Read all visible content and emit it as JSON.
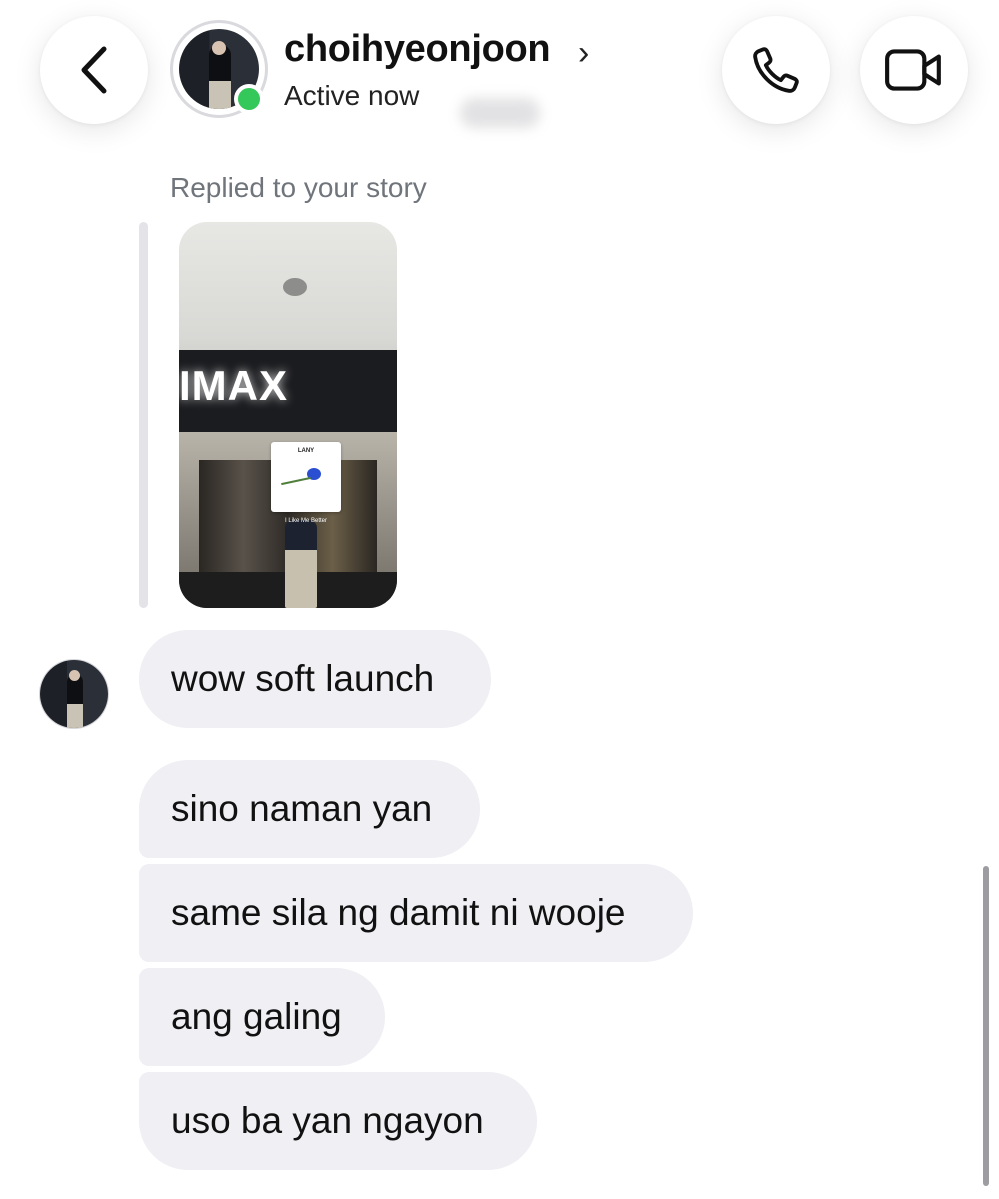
{
  "header": {
    "username": "choihyeonjoon",
    "status": "Active now",
    "chevron": "›",
    "icons": {
      "back": "chevron-left-icon",
      "call": "phone-icon",
      "video": "video-camera-icon"
    }
  },
  "story_reply": {
    "label": "Replied to your story",
    "sign_text": "IMAX",
    "sticker_title": "LANY",
    "sticker_song": "I Like Me Better"
  },
  "messages": [
    {
      "text": "wow soft launch"
    },
    {
      "text": "sino naman yan"
    },
    {
      "text": "same sila ng damit ni wooje"
    },
    {
      "text": "ang galing"
    },
    {
      "text": "uso ba yan ngayon"
    }
  ],
  "colors": {
    "online": "#34c759",
    "bubble": "#efeff4",
    "secondary_text": "#70757c"
  }
}
